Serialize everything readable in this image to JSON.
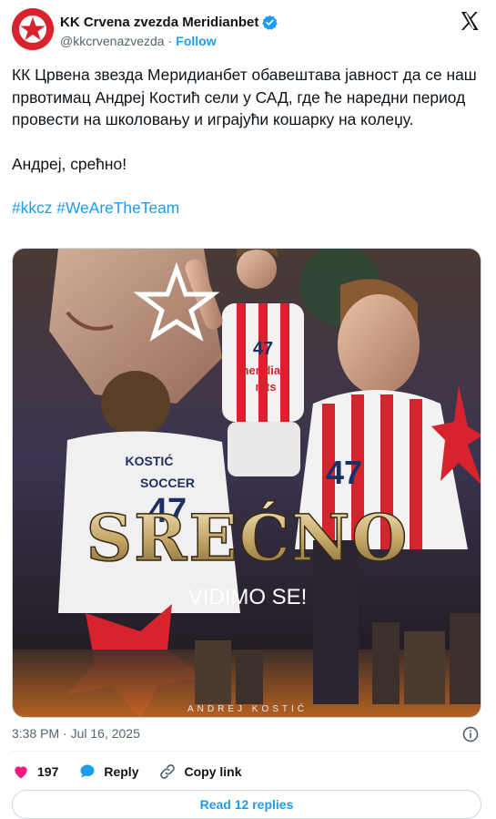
{
  "account": {
    "display_name": "KK Crvena zvezda Meridianbet",
    "handle": "@kkcrvenazvezda",
    "separator": "·",
    "follow_label": "Follow"
  },
  "tweet": {
    "line1": "КК Црвена звезда Меридианбет обавештава јавност да се наш првотимац Андреј Костић сели у САД, где ће наредни период провести на школовању и играјући кошарку на колеџу.",
    "line2": "Андреј, срећно!",
    "hashtags": "#kkcz #WeAreTheTeam"
  },
  "media": {
    "headline": "SREĆNO",
    "subline": "VIDIMO SE!",
    "credit": "ANDREJ KOSTIĆ",
    "jersey_number": "47",
    "jersey_sponsor": "meridian",
    "jersey_sponsor2": "mts",
    "back_name": "KOSTIĆ",
    "back_sponsor": "SOCCER"
  },
  "meta": {
    "timestamp": "3:38 PM · Jul 16, 2025"
  },
  "actions": {
    "likes": "197",
    "reply_label": "Reply",
    "copy_label": "Copy link"
  },
  "replies": {
    "label": "Read 12 replies"
  },
  "colors": {
    "accent": "#1d9bf0",
    "like": "#f91880",
    "club_red": "#d6232e"
  }
}
